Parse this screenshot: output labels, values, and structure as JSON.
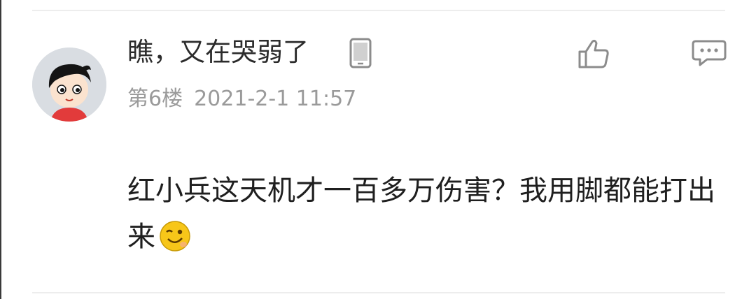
{
  "comment": {
    "username": "瞧，又在哭弱了",
    "floor": "第6楼",
    "time": "2021-2-1 11:57",
    "content": "红小兵这天机才一百多万伤害？我用脚都能打出来"
  },
  "icons": {
    "device": "phone-icon",
    "like": "thumbs-up-icon",
    "reply": "comment-bubble-icon",
    "emoji": "wink-emoji-icon"
  },
  "colors": {
    "username": "#2b2b2b",
    "meta": "#9a9a9a",
    "content": "#1f1f1f",
    "icon": "#8c8c8c",
    "divider": "#ededed"
  }
}
